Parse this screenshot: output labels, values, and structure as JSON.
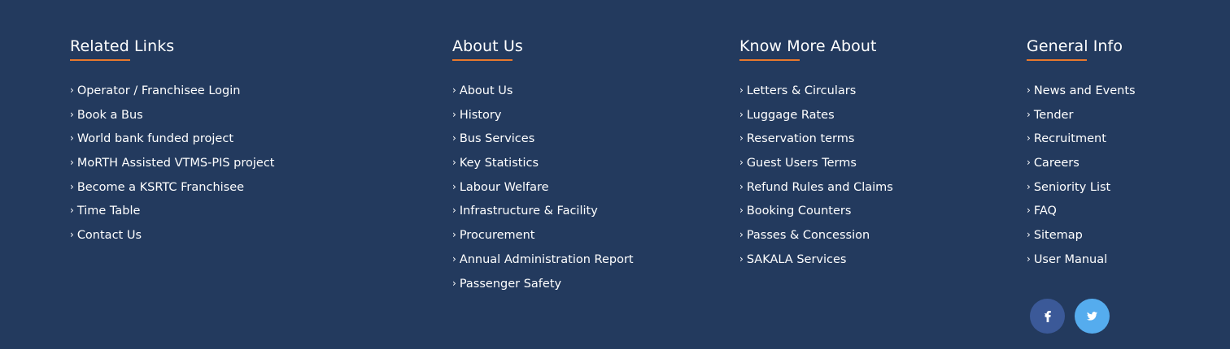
{
  "columns": [
    {
      "heading": "Related Links",
      "links": [
        "Operator / Franchisee Login",
        "Book a Bus",
        "World bank funded project",
        "MoRTH Assisted VTMS-PIS project",
        "Become a KSRTC Franchisee",
        "Time Table",
        "Contact Us"
      ]
    },
    {
      "heading": "About Us",
      "links": [
        "About Us",
        "History",
        "Bus Services",
        "Key Statistics",
        "Labour Welfare",
        "Infrastructure & Facility",
        "Procurement",
        "Annual Administration Report",
        "Passenger Safety"
      ]
    },
    {
      "heading": "Know More About",
      "links": [
        "Letters & Circulars",
        "Luggage Rates",
        "Reservation terms",
        "Guest Users Terms",
        "Refund Rules and Claims",
        "Booking Counters",
        "Passes & Concession",
        "SAKALA Services"
      ]
    },
    {
      "heading": "General Info",
      "links": [
        "News and Events",
        "Tender",
        "Recruitment",
        "Careers",
        "Seniority List",
        "FAQ",
        "Sitemap",
        "User Manual"
      ]
    }
  ],
  "chevron": "›",
  "social": [
    {
      "icon": "facebook-icon",
      "color": "#3b5998"
    },
    {
      "icon": "twitter-icon",
      "color": "#55acee"
    }
  ],
  "colors": {
    "background": "#233a5e",
    "accent": "#e8782d"
  }
}
